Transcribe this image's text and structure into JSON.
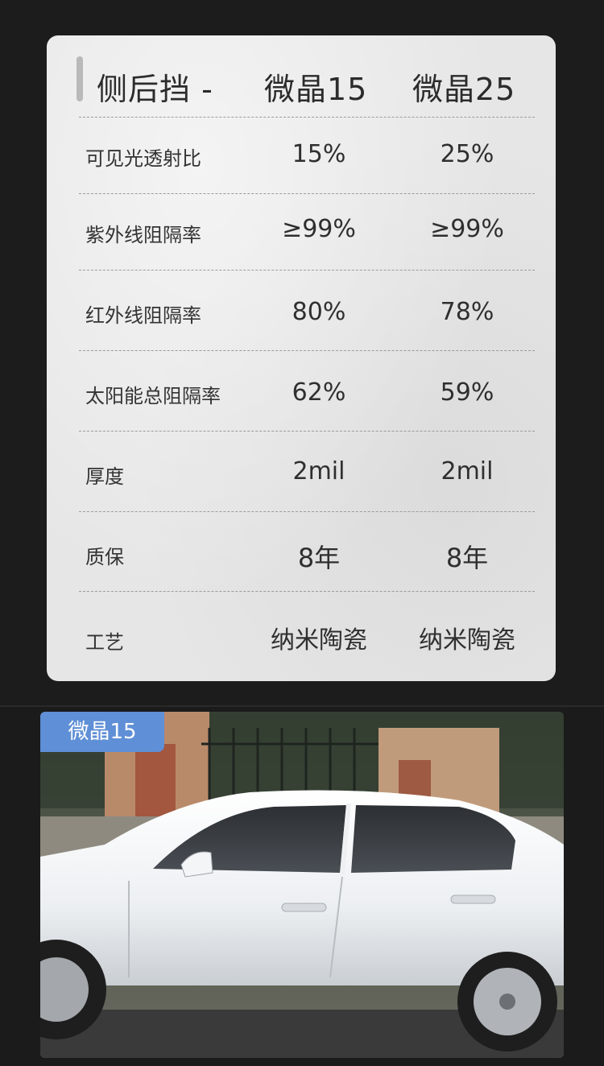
{
  "header": {
    "label": "侧后挡 -",
    "col_a": "微晶15",
    "col_b": "微晶25"
  },
  "rows": [
    {
      "label": "可见光透射比",
      "a": "15%",
      "b": "25%"
    },
    {
      "label": "紫外线阻隔率",
      "a": "≥99%",
      "b": "≥99%"
    },
    {
      "label": "红外线阻隔率",
      "a": "80%",
      "b": "78%"
    },
    {
      "label": "太阳能总阻隔率",
      "a": "62%",
      "b": "59%"
    },
    {
      "label": "厚度",
      "a": "2mil",
      "b": "2mil"
    },
    {
      "label": "质保",
      "a": "8年",
      "b": "8年"
    },
    {
      "label": "工艺",
      "a": "纳米陶瓷",
      "b": "纳米陶瓷"
    }
  ],
  "photo": {
    "badge": "微晶15"
  },
  "colors": {
    "badge": "#5f8fd6",
    "card": "#e6e6e6",
    "background": "#1b1b1b"
  }
}
